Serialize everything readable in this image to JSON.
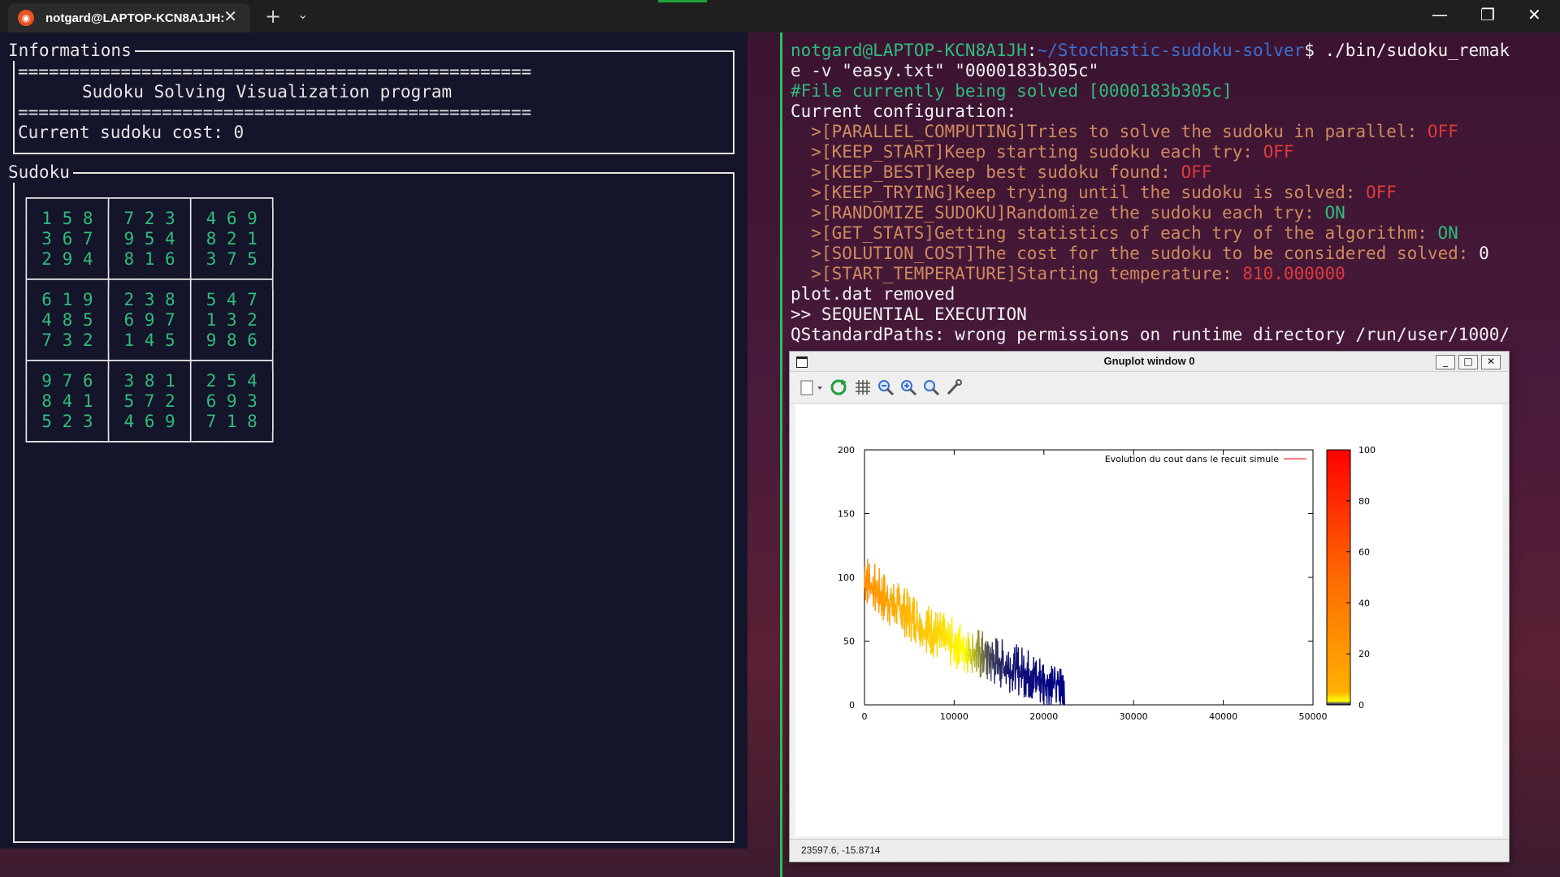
{
  "titlebar": {
    "tab_title": "notgard@LAPTOP-KCN8A1JH:",
    "new_tab": "+",
    "dropdown": "⌄",
    "minimize": "—",
    "maximize": "❐",
    "close": "✕"
  },
  "left": {
    "info_label": "Informations",
    "info_sep": "==================================================",
    "info_title": "Sudoku Solving Visualization program",
    "cost_line": "Current sudoku cost: 0",
    "sudoku_label": "Sudoku",
    "grid_top": "┌───────┬───────┬───────┐",
    "grid_mid": "├───────┼───────┼───────┤",
    "grid_bot": "└───────┴───────┴───────┘",
    "rows": [
      [
        "1 5 8",
        "7 2 3",
        "4 6 9"
      ],
      [
        "3 6 7",
        "9 5 4",
        "8 2 1"
      ],
      [
        "2 9 4",
        "8 1 6",
        "3 7 5"
      ],
      [
        "6 1 9",
        "2 3 8",
        "5 4 7"
      ],
      [
        "4 8 5",
        "6 9 7",
        "1 3 2"
      ],
      [
        "7 3 2",
        "1 4 5",
        "9 8 6"
      ],
      [
        "9 7 6",
        "3 8 1",
        "2 5 4"
      ],
      [
        "8 4 1",
        "5 7 2",
        "6 9 3"
      ],
      [
        "5 2 3",
        "4 6 9",
        "7 1 8"
      ]
    ]
  },
  "right": {
    "prompt_user": "notgard@LAPTOP-KCN8A1JH",
    "prompt_colon": ":",
    "prompt_path": "~/Stochastic-sudoku-solver",
    "prompt_cmd": "$ ./bin/sudoku_remak",
    "cmd_cont": "e -v \"easy.txt\" \"0000183b305c\"",
    "file_line": "#File currently being solved [0000183b305c]",
    "config_head": "Current configuration:",
    "config": [
      {
        "text": "  >[PARALLEL_COMPUTING]Tries to solve the sudoku in parallel: ",
        "val": "OFF",
        "val_class": "red"
      },
      {
        "text": "  >[KEEP_START]Keep starting sudoku each try: ",
        "val": "OFF",
        "val_class": "red"
      },
      {
        "text": "  >[KEEP_BEST]Keep best sudoku found: ",
        "val": "OFF",
        "val_class": "red"
      },
      {
        "text": "  >[KEEP_TRYING]Keep trying until the sudoku is solved: ",
        "val": "OFF",
        "val_class": "red"
      },
      {
        "text": "  >[RANDOMIZE_SUDOKU]Randomize the sudoku each try: ",
        "val": "ON",
        "val_class": "green"
      },
      {
        "text": "  >[GET_STATS]Getting statistics of each try of the algorithm: ",
        "val": "ON",
        "val_class": "green"
      },
      {
        "text": "  >[SOLUTION_COST]The cost for the sudoku to be considered solved: ",
        "val": "0",
        "val_class": "white"
      },
      {
        "text": "  >[START_TEMPERATURE]Starting temperature: ",
        "val": "810.000000",
        "val_class": "red"
      }
    ],
    "removed": "plot.dat removed",
    "seq": ">> SEQUENTIAL EXECUTION",
    "qt_warn": "QStandardPaths: wrong permissions on runtime directory /run/user/1000/"
  },
  "gnuplot": {
    "title": "Gnuplot window 0",
    "status": "23597.6, -15.8714",
    "legend": "Evolution du cout dans le recuit simule",
    "toolbar_icons": [
      "export-icon",
      "replot-icon",
      "grid-icon",
      "zoom-prev-icon",
      "zoom-next-icon",
      "autoscale-icon",
      "settings-icon"
    ],
    "chart_data": {
      "type": "line",
      "xlim": [
        0,
        50000
      ],
      "ylim": [
        0,
        200
      ],
      "xticks": [
        "0",
        "10000",
        "20000",
        "30000",
        "40000",
        "50000"
      ],
      "yticks": [
        "0",
        "50",
        "100",
        "150",
        "200"
      ],
      "cbticks": [
        "0",
        "20",
        "40",
        "60",
        "80",
        "100"
      ],
      "cbrange": [
        0,
        100
      ],
      "series": [
        {
          "name": "Evolution du cout dans le recuit simule",
          "x": [
            0,
            2000,
            4000,
            6000,
            8000,
            10000,
            12000,
            14000,
            16000,
            18000,
            20000,
            22300
          ],
          "y": [
            100,
            85,
            75,
            65,
            55,
            48,
            42,
            36,
            30,
            25,
            18,
            12
          ]
        }
      ],
      "colors": {
        "line": "#ff0000",
        "border": "#000000"
      }
    }
  }
}
